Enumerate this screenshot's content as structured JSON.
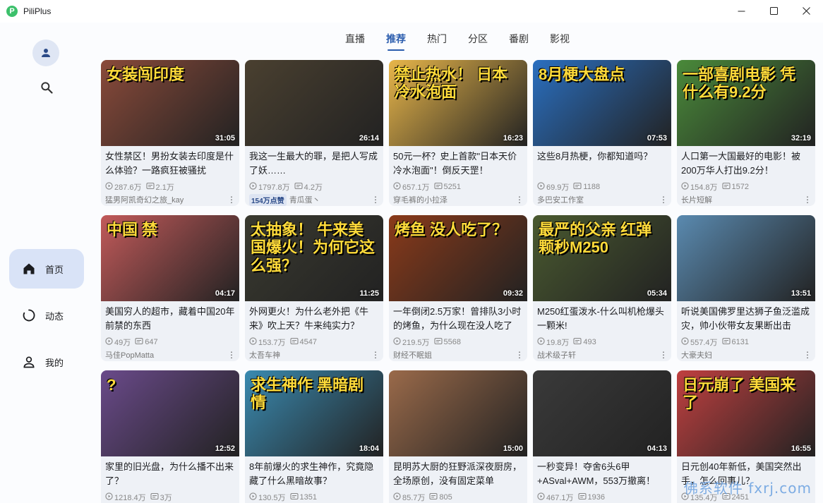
{
  "window": {
    "title": "PiliPlus",
    "logo_letter": "P",
    "min": "─",
    "max": "☐",
    "close": "✕"
  },
  "sidebar": {
    "nav": [
      {
        "label": "首页",
        "icon": "home-icon",
        "active": true
      },
      {
        "label": "动态",
        "icon": "dynamic-icon",
        "active": false
      },
      {
        "label": "我的",
        "icon": "person-icon",
        "active": false
      }
    ]
  },
  "tabs": [
    {
      "label": "直播",
      "active": false
    },
    {
      "label": "推荐",
      "active": true
    },
    {
      "label": "热门",
      "active": false
    },
    {
      "label": "分区",
      "active": false
    },
    {
      "label": "番剧",
      "active": false
    },
    {
      "label": "影视",
      "active": false
    }
  ],
  "videos": [
    {
      "title": "女性禁区！男扮女装去印度是什么体验？一路疯狂被骚扰",
      "thumb_text": "女装闯印度",
      "duration": "31:05",
      "views": "287.6万",
      "danmaku": "2.1万",
      "author": "猛男阿凯奇幻之旅_kay",
      "badge": "",
      "bg": "#8a4a3a"
    },
    {
      "title": "我这一生最大的罪，是把人写成了妖……",
      "thumb_text": "",
      "duration": "26:14",
      "views": "1797.8万",
      "danmaku": "4.2万",
      "author": "青瓜蛋丶",
      "badge": "154万点赞",
      "bg": "#4a4030"
    },
    {
      "title": "50元一杯？史上首款\"日本天价冷水泡面\"！倒反天罡！",
      "thumb_text": "禁止热水！ 日本冷水泡面",
      "duration": "16:23",
      "views": "657.1万",
      "danmaku": "5251",
      "author": "穿毛裤的小拉泽",
      "badge": "",
      "bg": "#e8b64a"
    },
    {
      "title": "这些8月热梗，你都知道吗？",
      "thumb_text": "8月梗大盘点",
      "duration": "07:53",
      "views": "69.9万",
      "danmaku": "1188",
      "author": "多巴安工作室",
      "badge": "",
      "bg": "#2a6fc0"
    },
    {
      "title": "人口第一大国最好的电影！被200万华人打出9.2分！",
      "thumb_text": "一部喜剧电影 凭什么有9.2分",
      "duration": "32:19",
      "views": "154.8万",
      "danmaku": "1572",
      "author": "长片短解",
      "badge": "",
      "bg": "#4a8a3a"
    },
    {
      "title": "美国穷人的超市，藏着中国20年前禁的东西",
      "thumb_text": "中国 禁",
      "duration": "04:17",
      "views": "49万",
      "danmaku": "647",
      "author": "马佳PopMatta",
      "badge": "",
      "bg": "#c25a5a"
    },
    {
      "title": "外网更火！为什么老外把《牛来》吹上天？牛来纯实力？",
      "thumb_text": "太抽象！ 牛来美国爆火！为何它这么强？",
      "duration": "11:25",
      "views": "153.7万",
      "danmaku": "4547",
      "author": "太吾车神",
      "badge": "",
      "bg": "#3a3a30"
    },
    {
      "title": "一年倒闭2.5万家！曾排队3小时的烤鱼，为什么现在没人吃了",
      "thumb_text": "烤鱼 没人吃了？",
      "duration": "09:32",
      "views": "219.5万",
      "danmaku": "5568",
      "author": "财经不眠姐",
      "badge": "",
      "bg": "#8a3a1a"
    },
    {
      "title": "M250红蛋泼水-什么叫机枪爆头一颗米!",
      "thumb_text": "最严的父亲 红弹颗秒M250",
      "duration": "05:34",
      "views": "19.8万",
      "danmaku": "493",
      "author": "战术级子轩",
      "badge": "",
      "bg": "#4a5a30"
    },
    {
      "title": "听说美国佛罗里达狮子鱼泛滥成灾，帅小伙带女友果断出击",
      "thumb_text": "",
      "duration": "13:51",
      "views": "557.4万",
      "danmaku": "6131",
      "author": "大豪夫妇",
      "badge": "",
      "bg": "#5a8ab0"
    },
    {
      "title": "家里的旧光盘，为什么播不出来了？",
      "thumb_text": "?",
      "duration": "12:52",
      "views": "1218.4万",
      "danmaku": "3万",
      "author": "",
      "badge": "",
      "bg": "#6a4a8a"
    },
    {
      "title": "8年前爆火的求生神作，究竟隐藏了什么黑暗故事？",
      "thumb_text": "求生神作 黑暗剧情",
      "duration": "18:04",
      "views": "130.5万",
      "danmaku": "1351",
      "author": "",
      "badge": "",
      "bg": "#3a8ab0"
    },
    {
      "title": "昆明苏大厨的狂野派深夜厨房，全场原创，没有固定菜单",
      "thumb_text": "",
      "duration": "15:00",
      "views": "85.7万",
      "danmaku": "805",
      "author": "",
      "badge": "",
      "bg": "#9a6a4a"
    },
    {
      "title": "一秒变异！夺舍6头6甲+ASval+AWM，553万撤离！",
      "thumb_text": "",
      "duration": "04:13",
      "views": "467.1万",
      "danmaku": "1936",
      "author": "",
      "badge": "",
      "bg": "#3a3a3a"
    },
    {
      "title": "日元创40年新低，美国突然出手，怎么回事儿？",
      "thumb_text": "日元崩了 美国来了",
      "duration": "16:55",
      "views": "135.4万",
      "danmaku": "2451",
      "author": "",
      "badge": "",
      "bg": "#c04040"
    }
  ],
  "watermark": "佛系软件 fxrj.com"
}
